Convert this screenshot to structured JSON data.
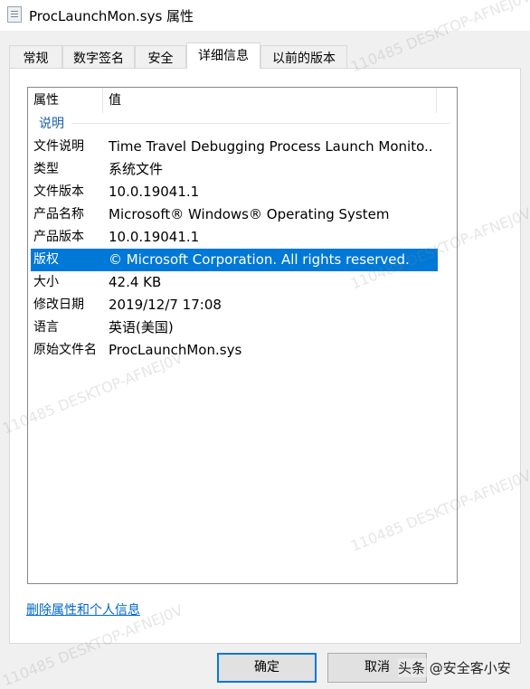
{
  "window": {
    "title": "ProcLaunchMon.sys 属性"
  },
  "tabs": [
    {
      "label": "常规"
    },
    {
      "label": "数字签名"
    },
    {
      "label": "安全"
    },
    {
      "label": "详细信息"
    },
    {
      "label": "以前的版本"
    }
  ],
  "active_tab": "详细信息",
  "details": {
    "columns": {
      "property": "属性",
      "value": "值"
    },
    "group": "说明",
    "rows": [
      {
        "key": "文件说明",
        "value": "Time Travel Debugging Process Launch Monito..."
      },
      {
        "key": "类型",
        "value": "系统文件"
      },
      {
        "key": "文件版本",
        "value": "10.0.19041.1"
      },
      {
        "key": "产品名称",
        "value": "Microsoft® Windows® Operating System"
      },
      {
        "key": "产品版本",
        "value": "10.0.19041.1"
      },
      {
        "key": "版权",
        "value": "© Microsoft Corporation. All rights reserved."
      },
      {
        "key": "大小",
        "value": "42.4 KB"
      },
      {
        "key": "修改日期",
        "value": "2019/12/7 17:08"
      },
      {
        "key": "语言",
        "value": "英语(美国)"
      },
      {
        "key": "原始文件名",
        "value": "ProcLaunchMon.sys"
      }
    ],
    "selected_row": "版权"
  },
  "remove_link": "删除属性和个人信息",
  "buttons": {
    "ok": "确定",
    "cancel": "取消"
  },
  "watermark": "110485 DESKTOP-AFNEJ0V",
  "overlay_credit": "头条 @安全客小安"
}
